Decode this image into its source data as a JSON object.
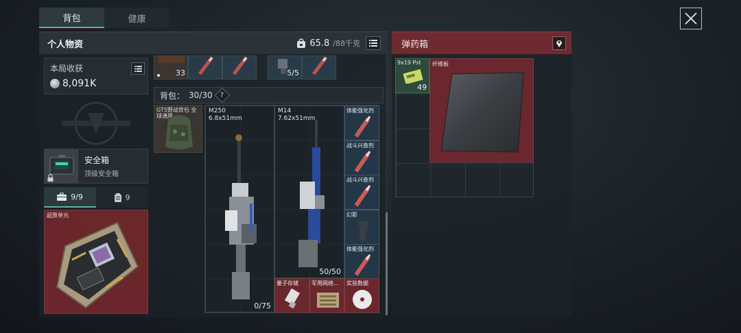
{
  "tabs": [
    {
      "label": "背包",
      "active": true
    },
    {
      "label": "健康",
      "active": false
    }
  ],
  "personal": {
    "title": "个人物资",
    "weight_current": "65.8",
    "weight_max": "/88千克"
  },
  "harvest": {
    "label": "本局收获",
    "value": "8,091K"
  },
  "safe_box": {
    "name": "安全箱",
    "type": "顶级安全箱"
  },
  "sub_tabs": [
    {
      "label": "9/9",
      "icon": "briefcase-icon",
      "active": true
    },
    {
      "label": "9",
      "icon": "canister-icon",
      "active": false
    }
  ],
  "special_slot": {
    "label": "超算单元"
  },
  "top_row": {
    "count_1": "33",
    "count_2": "5/5"
  },
  "backpack": {
    "label": "背包：",
    "capacity": "30/30",
    "help": "?",
    "bag_name": "GT5野战背包 全球通用"
  },
  "weapons": [
    {
      "name": "M250",
      "ammo": "6.8x51mm",
      "count": "0/75"
    },
    {
      "name": "M14",
      "ammo": "7.62x51mm",
      "count": "50/50"
    }
  ],
  "consumables": [
    {
      "label": "体能强化剂"
    },
    {
      "label": "战斗兴奋剂"
    },
    {
      "label": "战斗兴奋剂"
    },
    {
      "label": "幻影"
    },
    {
      "label": "体能强化剂"
    }
  ],
  "bottom_items": [
    {
      "label": "量子存储"
    },
    {
      "label": "军用网络..."
    },
    {
      "label": "实验数据"
    }
  ],
  "ammo_box": {
    "title": "弹药箱",
    "ammo_item": {
      "label": "9x19 Pst",
      "count": "49"
    },
    "fiber_label": "纤维板"
  },
  "colors": {
    "accent": "#3fbfa0",
    "rare_red": "#7a2a31",
    "ammo_header": "#6d2a31"
  }
}
